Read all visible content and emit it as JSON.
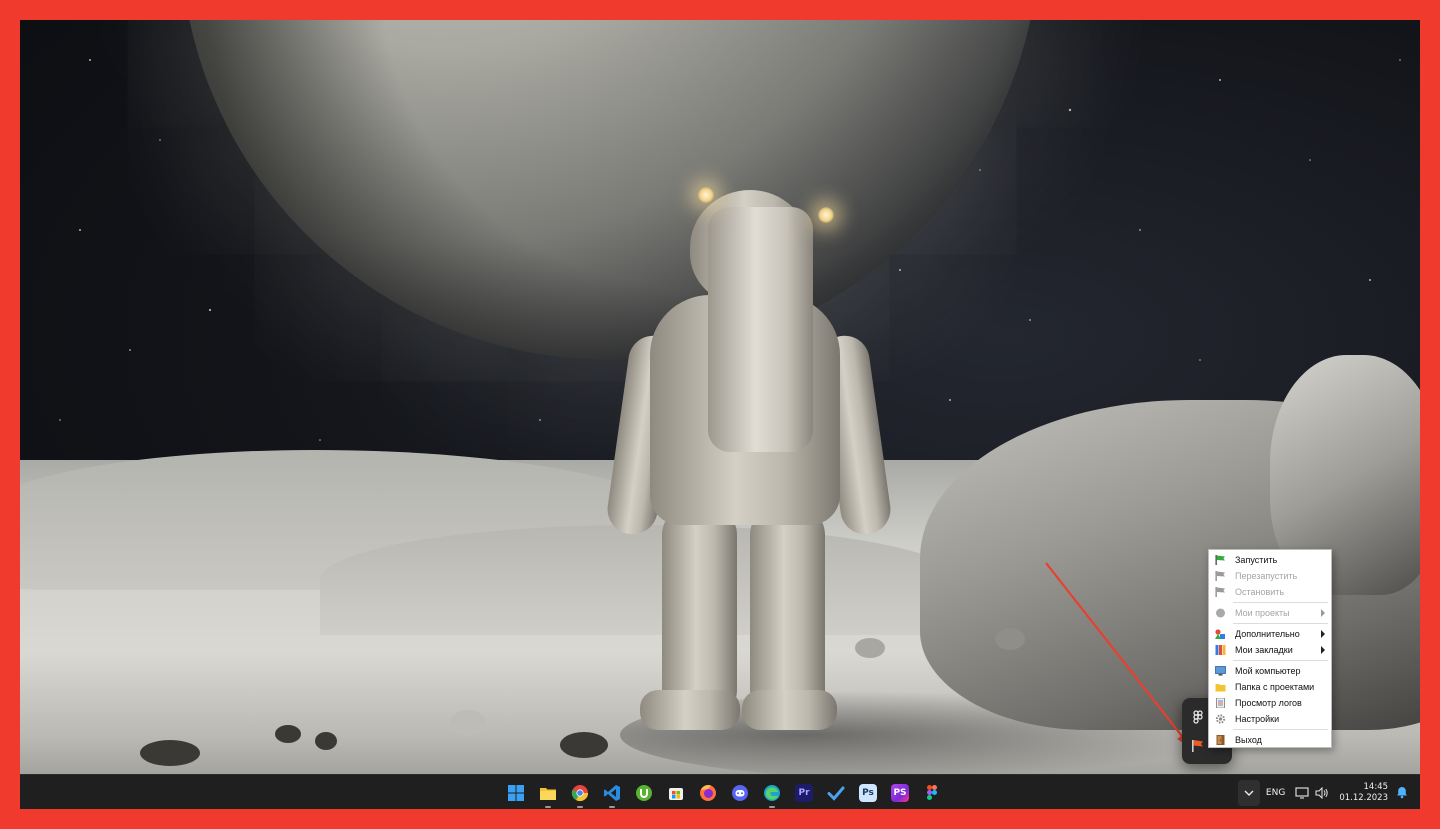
{
  "frame": {
    "border_color": "#f03a2e"
  },
  "desktop": {
    "wallpaper": "astronaut-on-moon"
  },
  "context_menu": {
    "items": [
      {
        "label": "Запустить",
        "icon": "green-flag-icon",
        "disabled": false,
        "submenu": false
      },
      {
        "label": "Перезапустить",
        "icon": "gray-flag-icon",
        "disabled": true,
        "submenu": false
      },
      {
        "label": "Остановить",
        "icon": "gray-flag-icon",
        "disabled": true,
        "submenu": false
      },
      {
        "label": "Мои проекты",
        "icon": "gray-circle-icon",
        "disabled": true,
        "submenu": true
      },
      {
        "label": "Дополнительно",
        "icon": "shapes-icon",
        "disabled": false,
        "submenu": true
      },
      {
        "label": "Мои закладки",
        "icon": "bookmarks-icon",
        "disabled": false,
        "submenu": true
      },
      {
        "label": "Мой компьютер",
        "icon": "computer-icon",
        "disabled": false,
        "submenu": false
      },
      {
        "label": "Папка с проектами",
        "icon": "folder-icon",
        "disabled": false,
        "submenu": false
      },
      {
        "label": "Просмотр логов",
        "icon": "log-icon",
        "disabled": false,
        "submenu": false
      },
      {
        "label": "Настройки",
        "icon": "gear-icon",
        "disabled": false,
        "submenu": false
      },
      {
        "label": "Выход",
        "icon": "exit-door-icon",
        "disabled": false,
        "submenu": false
      }
    ]
  },
  "tray_overflow": {
    "icons": [
      "figma-tray-icon",
      "app-flag-tray-icon"
    ]
  },
  "taskbar": {
    "apps": [
      {
        "name": "windows-start-icon",
        "color": "#3aa0f3"
      },
      {
        "name": "file-explorer-icon",
        "color": "#f4c430"
      },
      {
        "name": "chrome-icon",
        "color": "#e8453c"
      },
      {
        "name": "vscode-icon",
        "color": "#2a8ce0"
      },
      {
        "name": "utorrent-icon",
        "color": "#58b430"
      },
      {
        "name": "store-icon",
        "color": "#f0f0f0"
      },
      {
        "name": "firefox-icon",
        "color": "#ff7139"
      },
      {
        "name": "discord-icon",
        "color": "#5865f2"
      },
      {
        "name": "edge-icon",
        "color": "#1fa3c9"
      },
      {
        "name": "premiere-icon",
        "color": "#1c1c6b",
        "text": "Pr"
      },
      {
        "name": "todo-icon",
        "color": "#4aa3f2"
      },
      {
        "name": "photoshop-icon",
        "color": "#1c3a66",
        "text": "Ps"
      },
      {
        "name": "phpstorm-icon",
        "color": "#7b2bd6",
        "text": "PS"
      },
      {
        "name": "figma-icon",
        "color": "#f24e1e"
      }
    ],
    "language": "ENG",
    "time": "14:45",
    "date": "01.12.2023"
  }
}
